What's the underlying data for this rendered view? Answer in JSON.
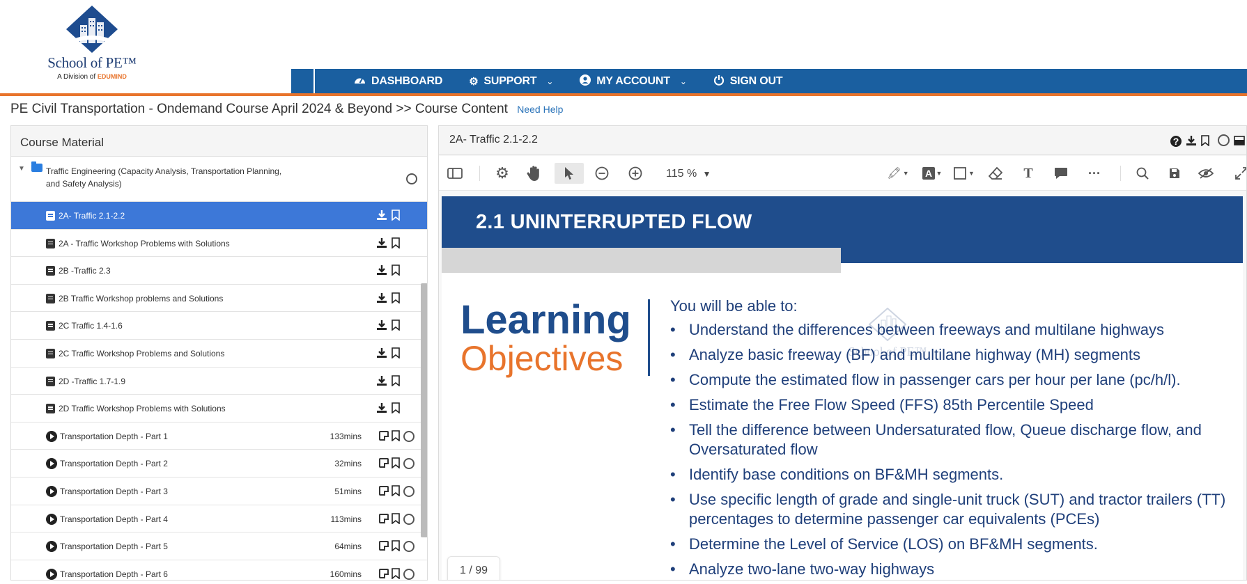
{
  "logo": {
    "brand": "School of PE™",
    "sub_prefix": "A Division of",
    "sub_brand": "EDUMIND"
  },
  "nav": {
    "items": [
      {
        "label": "DASHBOARD",
        "icon": "dashboard-icon"
      },
      {
        "label": "SUPPORT",
        "icon": "gear-icon"
      },
      {
        "label": "MY ACCOUNT",
        "icon": "user-circle-icon"
      },
      {
        "label": "SIGN OUT",
        "icon": "power-icon"
      }
    ]
  },
  "breadcrumb": {
    "text": "PE Civil Transportation - Ondemand Course April 2024 & Beyond >> Course Content",
    "help": "Need Help"
  },
  "left_panel": {
    "title": "Course Material",
    "folder": {
      "label": "Traffic Engineering (Capacity Analysis, Transportation Planning, and Safety Analysis)"
    },
    "docs": [
      {
        "label": "2A- Traffic 2.1-2.2"
      },
      {
        "label": "2A - Traffic Workshop Problems with Solutions"
      },
      {
        "label": "2B -Traffic 2.3"
      },
      {
        "label": "2B Traffic Workshop problems and Solutions"
      },
      {
        "label": "2C Traffic 1.4-1.6"
      },
      {
        "label": "2C Traffic Workshop Problems and Solutions"
      },
      {
        "label": "2D -Traffic 1.7-1.9"
      },
      {
        "label": "2D Traffic Workshop Problems with Solutions"
      }
    ],
    "videos": [
      {
        "label": "Transportation Depth - Part 1",
        "duration": "133mins"
      },
      {
        "label": "Transportation Depth - Part 2",
        "duration": "32mins"
      },
      {
        "label": "Transportation Depth - Part 3",
        "duration": "51mins"
      },
      {
        "label": "Transportation Depth - Part 4",
        "duration": "113mins"
      },
      {
        "label": "Transportation Depth - Part 5",
        "duration": "64mins"
      },
      {
        "label": "Transportation Depth - Part 6",
        "duration": "160mins"
      }
    ]
  },
  "viewer": {
    "title": "2A- Traffic 2.1-2.2",
    "zoom": "115 %",
    "page_current": "1",
    "page_total": "99",
    "slide": {
      "banner": "2.1 UNINTERRUPTED FLOW",
      "heading_1": "Learning",
      "heading_2": "Objectives",
      "intro": "You will be able to:",
      "bullets": [
        "Understand the differences between freeways and multilane highways",
        "Analyze basic freeway (BF) and multilane highway (MH) segments",
        "Compute the estimated flow in passenger cars per hour per lane (pc/h/l).",
        "Estimate the Free Flow Speed (FFS) 85th Percentile Speed",
        "Tell the difference between Undersaturated flow, Queue discharge flow, and Oversaturated flow",
        "Identify base conditions on BF&MH segments.",
        "Use specific length of grade and single-unit truck (SUT) and tractor trailers (TT) percentages to determine passenger car equivalents (PCEs)",
        "Determine the Level of Service (LOS) on BF&MH segments.",
        "Analyze two-lane two-way highways"
      ],
      "watermark": "School of PE™"
    }
  },
  "colors": {
    "nav": "#1a5fa0",
    "accent": "#e8742c",
    "active_row": "#3d78d8",
    "slide_blue": "#1f4d8c"
  }
}
